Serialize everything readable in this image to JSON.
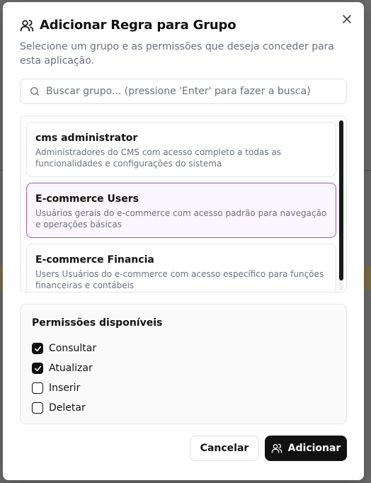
{
  "dialog": {
    "title": "Adicionar Regra para Grupo",
    "subtitle": "Selecione um grupo e as permissões que deseja conceder para esta aplicação.",
    "title_icon": "users-icon",
    "close_icon": "close-icon"
  },
  "search": {
    "placeholder": "Buscar grupo... (pressione 'Enter' para fazer a busca)",
    "value": "",
    "icon": "search-icon"
  },
  "groups": [
    {
      "name": "cms administrator",
      "description": "Administradores do CMS com acesso completo a todas as funcionalidades e configurações do sistema",
      "selected": false
    },
    {
      "name": "E-commerce Users",
      "description": "Usuários gerais do e-commerce com acesso padrão para navegação e operações básicas",
      "selected": true
    },
    {
      "name": "E-commerce Financia",
      "description": "Users Usuários do e-commerce com acesso específico para funções financeiras e contábeis",
      "selected": false
    }
  ],
  "permissions": {
    "title": "Permissões disponíveis",
    "items": [
      {
        "label": "Consultar",
        "checked": true
      },
      {
        "label": "Atualizar",
        "checked": true
      },
      {
        "label": "Inserir",
        "checked": false
      },
      {
        "label": "Deletar",
        "checked": false
      }
    ]
  },
  "footer": {
    "cancel_label": "Cancelar",
    "add_label": "Adicionar",
    "add_icon": "users-icon"
  },
  "colors": {
    "selected_border": "#a855c7",
    "selected_bg": "#fbf5fd",
    "primary": "#111111"
  }
}
